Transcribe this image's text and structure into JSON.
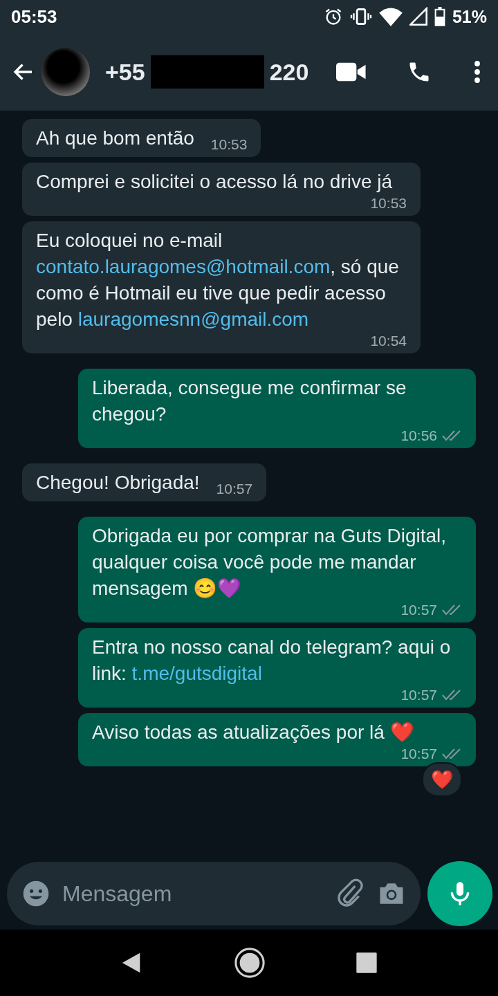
{
  "status_bar": {
    "time": "05:53",
    "battery": "51%"
  },
  "contact": {
    "name_start": "+55",
    "name_end": "220"
  },
  "messages": [
    {
      "outgoing": false,
      "parts": [
        {
          "kind": "text",
          "text": "Ah que bom então"
        }
      ],
      "time": "10:53"
    },
    {
      "outgoing": false,
      "parts": [
        {
          "kind": "text",
          "text": "Comprei e solicitei o acesso lá no drive já"
        }
      ],
      "time": "10:53"
    },
    {
      "outgoing": false,
      "parts": [
        {
          "kind": "text",
          "text": "Eu coloquei no e-mail "
        },
        {
          "kind": "link",
          "text": "contato.lauragomes@hotmail.com"
        },
        {
          "kind": "text",
          "text": ", só que como é Hotmail eu tive que pedir acesso pelo "
        },
        {
          "kind": "link",
          "text": "lauragomesnn@gmail.com"
        }
      ],
      "time": "10:54"
    },
    {
      "outgoing": true,
      "parts": [
        {
          "kind": "text",
          "text": "Liberada, consegue me confirmar se chegou?"
        }
      ],
      "time": "10:56",
      "read": false
    },
    {
      "outgoing": false,
      "parts": [
        {
          "kind": "text",
          "text": "Chegou! Obrigada!"
        }
      ],
      "time": "10:57"
    },
    {
      "outgoing": true,
      "parts": [
        {
          "kind": "text",
          "text": "Obrigada eu por comprar na Guts Digital, qualquer coisa você pode me mandar mensagem 😊💜"
        }
      ],
      "time": "10:57",
      "read": false
    },
    {
      "outgoing": true,
      "parts": [
        {
          "kind": "text",
          "text": "Entra no nosso canal do telegram? aqui o link: "
        },
        {
          "kind": "link",
          "text": "t.me/gutsdigital"
        }
      ],
      "time": "10:57",
      "read": false
    },
    {
      "outgoing": true,
      "parts": [
        {
          "kind": "text",
          "text": "Aviso todas as atualizações por lá ❤️"
        }
      ],
      "time": "10:57",
      "read": false,
      "reaction": "❤️"
    }
  ],
  "composer": {
    "placeholder": "Mensagem"
  }
}
